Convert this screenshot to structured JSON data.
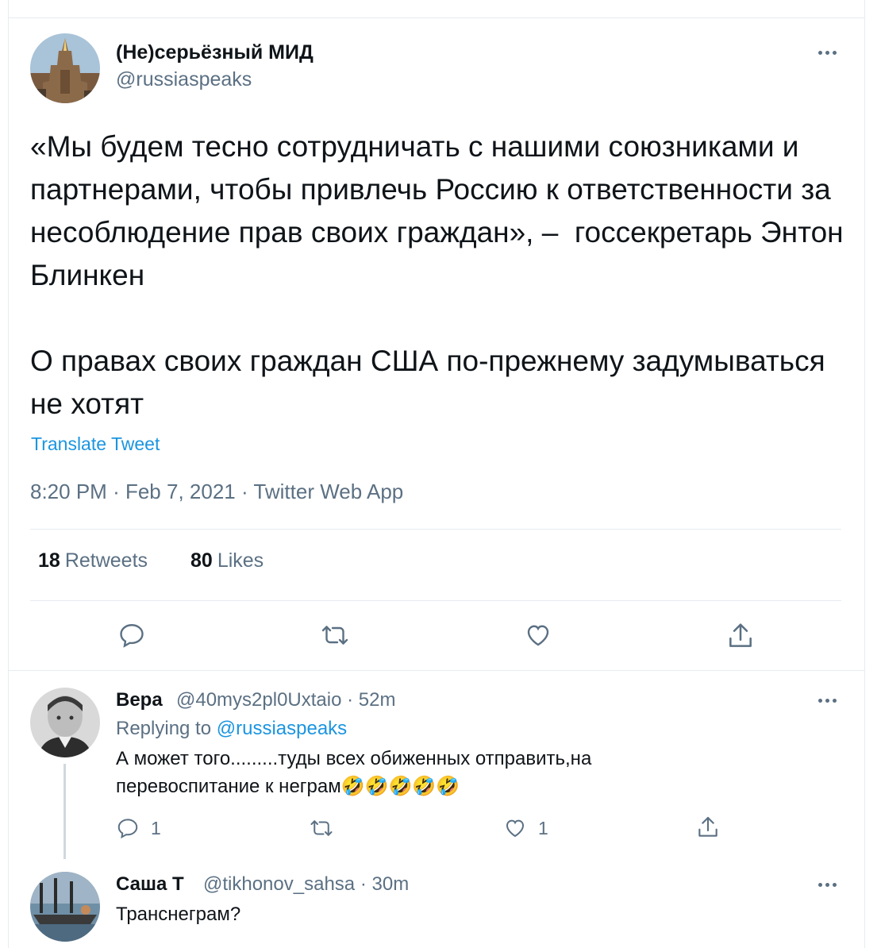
{
  "tweet": {
    "author_name": "(Не)серьёзный МИД",
    "author_handle": "@russiaspeaks",
    "text": "«Мы будем тесно сотрудничать с нашими союзниками и партнерами, чтобы привлечь Россию к ответственности за несоблюдение прав своих граждан», –  госсекретарь Энтон Блинкен\n\nО правах своих граждан США по-прежнему задумываться не хотят",
    "translate_label": "Translate Tweet",
    "time": "8:20 PM",
    "date": "Feb 7, 2021",
    "source": "Twitter Web App",
    "retweets_count": "18",
    "retweets_label": "Retweets",
    "likes_count": "80",
    "likes_label": "Likes"
  },
  "replies": [
    {
      "author_name": "Вера",
      "author_handle": "@40mys2pl0Uxtaio",
      "time": "52m",
      "replying_prefix": "Replying to",
      "replying_to": "@russiaspeaks",
      "text": "А может того.........туды всех обиженных отправить,на\nперевоспитание к неграм🤣🤣🤣🤣🤣",
      "reply_count": "1",
      "like_count": "1"
    },
    {
      "author_name": "Саша Т",
      "author_handle": "@tikhonov_sahsa",
      "time": "30m",
      "text": "Транснеграм?"
    }
  ],
  "separator": "·",
  "colors": {
    "accent": "#1b95e0",
    "muted": "#5b7083",
    "border": "#e6ecf0"
  },
  "icons": [
    "more-icon",
    "reply-icon",
    "retweet-icon",
    "like-icon",
    "share-icon"
  ]
}
